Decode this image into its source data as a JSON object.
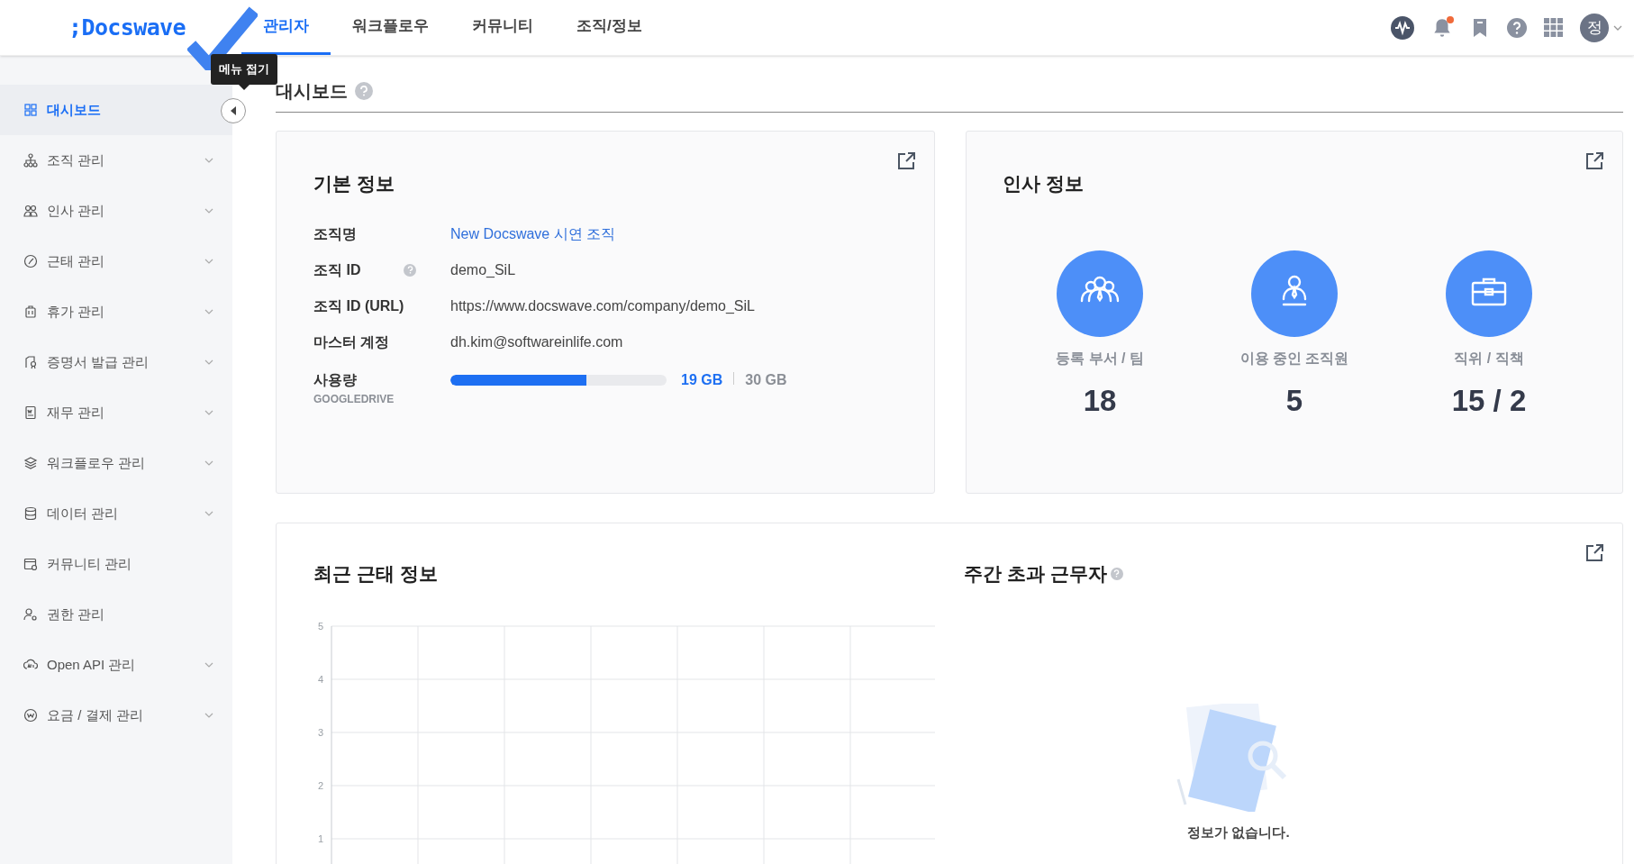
{
  "header": {
    "logo": ";Docswave",
    "tabs": [
      {
        "label": "관리자",
        "selected": true
      },
      {
        "label": "워크플로우",
        "selected": false
      },
      {
        "label": "커뮤니티",
        "selected": false
      },
      {
        "label": "조직/정보",
        "selected": false
      }
    ],
    "notification_badge": true,
    "avatar": "정"
  },
  "tooltip": "메뉴 접기",
  "sidebar": {
    "items": [
      {
        "label": "대시보드",
        "selected": true,
        "expandable": false
      },
      {
        "label": "조직 관리",
        "selected": false,
        "expandable": true
      },
      {
        "label": "인사 관리",
        "selected": false,
        "expandable": true
      },
      {
        "label": "근태 관리",
        "selected": false,
        "expandable": true
      },
      {
        "label": "휴가 관리",
        "selected": false,
        "expandable": true
      },
      {
        "label": "증명서 발급 관리",
        "selected": false,
        "expandable": true
      },
      {
        "label": "재무 관리",
        "selected": false,
        "expandable": true
      },
      {
        "label": "워크플로우 관리",
        "selected": false,
        "expandable": true
      },
      {
        "label": "데이터 관리",
        "selected": false,
        "expandable": true
      },
      {
        "label": "커뮤니티 관리",
        "selected": false,
        "expandable": false
      },
      {
        "label": "권한 관리",
        "selected": false,
        "expandable": false
      },
      {
        "label": "Open API 관리",
        "selected": false,
        "expandable": true
      },
      {
        "label": "요금 / 결제 관리",
        "selected": false,
        "expandable": true
      }
    ]
  },
  "page_title": "대시보드",
  "basic_info": {
    "title": "기본 정보",
    "rows": [
      {
        "kind": "link",
        "label": "조직명",
        "value": "New Docswave 시연 조직"
      },
      {
        "kind": "help",
        "label": "조직 ID",
        "value": "demo_SiL"
      },
      {
        "kind": "text",
        "label": "조직 ID (URL)",
        "value": "https://www.docswave.com/company/demo_SiL"
      },
      {
        "kind": "text",
        "label": "마스터 계정",
        "value": "dh.kim@softwareinlife.com"
      }
    ],
    "usage": {
      "label": "사용량",
      "sublabel": "GOOGLEDRIVE",
      "level": 0.63,
      "used": "19 GB",
      "total": "30 GB"
    }
  },
  "hr_info": {
    "title": "인사 정보",
    "stats": [
      {
        "kind": "team",
        "label": "등록 부서 / 팀",
        "value": "18"
      },
      {
        "kind": "person",
        "label": "이용 중인 조직원",
        "value": "5"
      },
      {
        "kind": "briefcase",
        "label": "직위 / 직책",
        "value": "15 / 2"
      }
    ]
  },
  "attendance": {
    "title": "최근 근태 정보",
    "axis_labels": [
      "5",
      "4",
      "3",
      "2",
      "1"
    ]
  },
  "overtime": {
    "title": "주간 초과 근무자",
    "empty_text": "정보가 없습니다."
  }
}
